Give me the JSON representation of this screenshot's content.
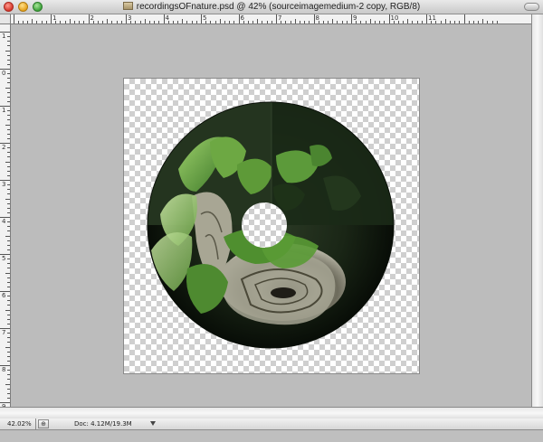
{
  "window": {
    "title": "recordingsOFnature.psd @ 42% (sourceimagemedium-2 copy, RGB/8)"
  },
  "ruler": {
    "horizontal_labels": [
      "1",
      "2",
      "3",
      "4",
      "5",
      "6",
      "7",
      "8",
      "9",
      "10",
      "11"
    ],
    "vertical_labels": [
      "1",
      "0",
      "1",
      "2",
      "3",
      "4",
      "5",
      "6",
      "7",
      "8",
      "9"
    ]
  },
  "status": {
    "zoom": "42.02%",
    "doc_size": "Doc: 4.12M/19.3M"
  },
  "colors": {
    "ring_dark": "#0f1a0d",
    "leaf_green": "#5f9e3a",
    "wood_gray": "#8a8a72"
  }
}
